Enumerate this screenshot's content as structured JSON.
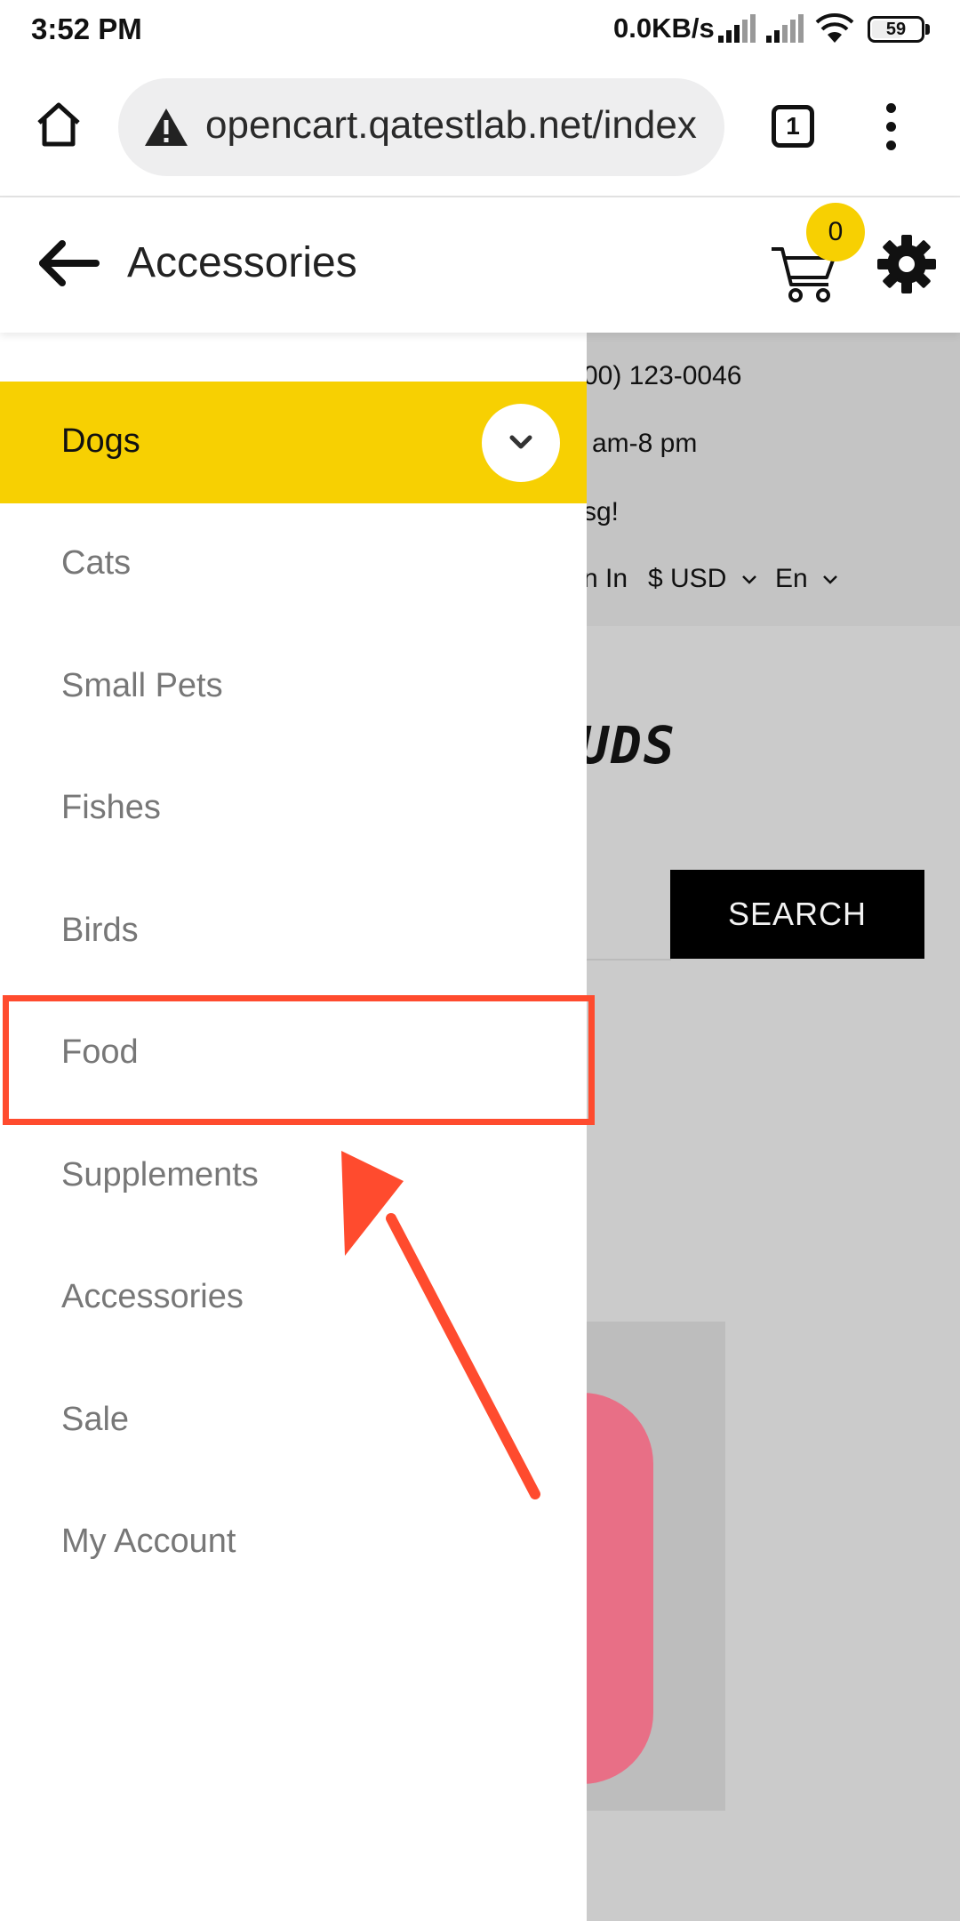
{
  "status_bar": {
    "time": "3:52 PM",
    "speed": "0.0KB/s",
    "battery": "59",
    "battery_level": 0.59
  },
  "browser": {
    "url": "opencart.qatestlab.net/index",
    "tab_count": "1"
  },
  "header": {
    "title": "Accessories",
    "cart_count": "0"
  },
  "background_page": {
    "phone": "00) 123-0046",
    "hours": "am-8 pm",
    "message": "sg!",
    "sign_in": "n In",
    "currency": "$ USD",
    "language": "En",
    "logo": "UDS",
    "search_label": "SEARCH"
  },
  "drawer": {
    "items": [
      {
        "label": "Dogs"
      },
      {
        "label": "Cats"
      },
      {
        "label": "Small Pets"
      },
      {
        "label": "Fishes"
      },
      {
        "label": "Birds"
      },
      {
        "label": "Food"
      },
      {
        "label": "Supplements"
      },
      {
        "label": "Accessories"
      },
      {
        "label": "Sale"
      },
      {
        "label": "My Account"
      }
    ]
  },
  "colors": {
    "accent": "#f7d002",
    "highlight": "#ff4b2e",
    "overlay": "#cbcbcb"
  }
}
